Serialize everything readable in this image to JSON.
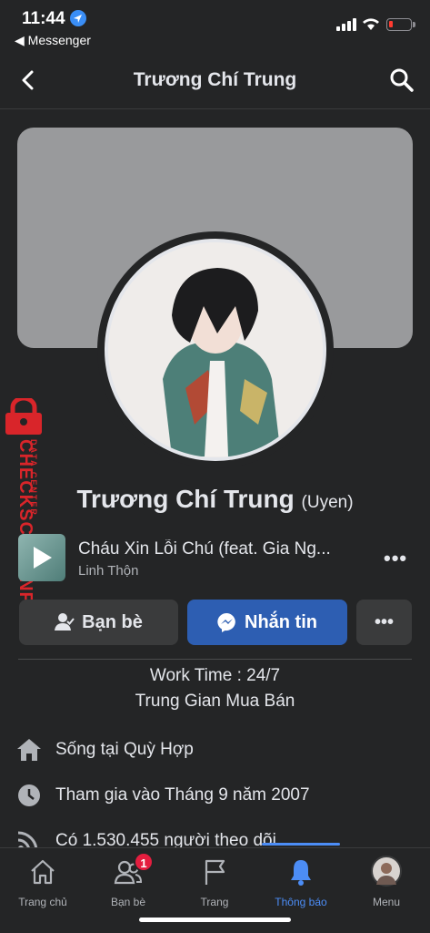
{
  "status_bar": {
    "time": "11:44",
    "back_app": "◀ Messenger"
  },
  "nav": {
    "title": "Trương Chí Trung"
  },
  "watermark": {
    "text": "CHECKSCAM.INFO",
    "sub": "DATA CENTER"
  },
  "profile": {
    "name": "Trương Chí Trung",
    "alt_name": "(Uyen)"
  },
  "music": {
    "song": "Cháu Xin Lỗi Chú (feat. Gia Ng...",
    "artist": "Linh Thộn",
    "more": "•••"
  },
  "actions": {
    "friends_label": "Bạn bè",
    "message_label": "Nhắn tin",
    "more_label": "•••"
  },
  "bio": {
    "line1": "Work Time : 24/7",
    "line2": "Trung Gian Mua Bán"
  },
  "info": [
    {
      "icon": "home-icon",
      "prefix": "Sống tại ",
      "value": "Quỳ Hợp"
    },
    {
      "icon": "clock-icon",
      "text": "Tham gia vào Tháng 9 năm 2007"
    },
    {
      "icon": "rss-icon",
      "text": "Có 1.530.455 người theo dõi"
    }
  ],
  "tabs": [
    {
      "label": "Trang chủ",
      "icon": "home-icon"
    },
    {
      "label": "Bạn bè",
      "icon": "friends-icon",
      "badge": "1"
    },
    {
      "label": "Trang",
      "icon": "flag-icon"
    },
    {
      "label": "Thông báo",
      "icon": "bell-icon",
      "active": true
    },
    {
      "label": "Menu",
      "icon": "avatar-icon"
    }
  ],
  "colors": {
    "accent": "#4c8df6",
    "message_button": "#2d5eb2",
    "background": "#242526",
    "watermark": "#d9252a"
  }
}
